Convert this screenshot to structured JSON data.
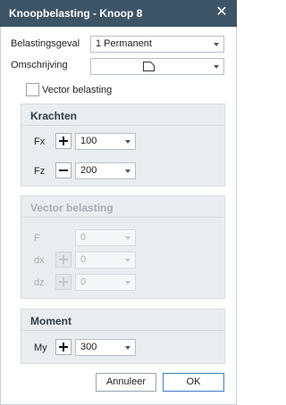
{
  "titlebar": {
    "title": "Knoopbelasting - Knoop  8",
    "close_icon": "close-icon"
  },
  "form": {
    "belastingsgeval_label": "Belastingsgeval",
    "belastingsgeval_value": "1 Permanent",
    "omschrijving_label": "Omschrijving",
    "omschrijving_value": "",
    "vector_checkbox_label": "Vector belasting",
    "vector_checkbox_checked": false
  },
  "krachten": {
    "title": "Krachten",
    "fx_label": "Fx",
    "fx_sign": "+",
    "fx_value": "100",
    "fz_label": "Fz",
    "fz_sign": "−",
    "fz_value": "200"
  },
  "vector": {
    "title": "Vector belasting",
    "f_label": "F",
    "f_value": "0",
    "dx_label": "dx",
    "dx_value": "0",
    "dz_label": "dz",
    "dz_value": "0"
  },
  "moment": {
    "title": "Moment",
    "my_label": "My",
    "my_sign": "+",
    "my_value": "300"
  },
  "buttons": {
    "cancel": "Annuleer",
    "ok": "OK"
  },
  "colors": {
    "titlebar": "#3d5466",
    "group_bg": "#e9edf0",
    "ok_border": "#3f7fc0"
  }
}
